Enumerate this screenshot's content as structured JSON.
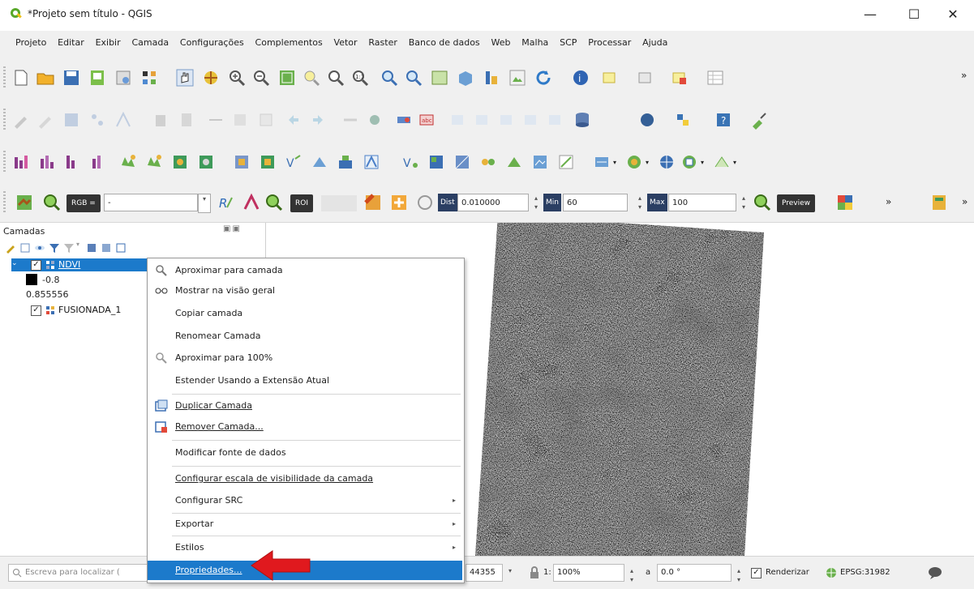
{
  "window": {
    "title": "*Projeto sem título - QGIS",
    "min_glyph": "—",
    "max_glyph": "☐",
    "close_glyph": "✕"
  },
  "menubar": [
    "Projeto",
    "Editar",
    "Exibir",
    "Camada",
    "Configurações",
    "Complementos",
    "Vetor",
    "Raster",
    "Banco de dados",
    "Web",
    "Malha",
    "SCP",
    "Processar",
    "Ajuda"
  ],
  "scp_toolbar": {
    "rgb_label": "RGB =",
    "rgb_value": "-",
    "roi_label": "ROI",
    "dist_label": "Dist",
    "dist_value": "0.010000",
    "min_label": "Min",
    "min_value": "60",
    "max_label": "Max",
    "max_value": "100",
    "preview_label": "Preview",
    "overflow": "»"
  },
  "layers_panel": {
    "title": "Camadas",
    "layers": [
      {
        "name": "NDVI",
        "checked": true,
        "selected": true
      },
      {
        "name": "FUSIONADA_1",
        "checked": true,
        "selected": false
      }
    ],
    "legend": [
      {
        "label": "-0.8",
        "color": "#000000"
      },
      {
        "label": "0.855556",
        "color": "#ffffff"
      }
    ]
  },
  "context_menu": {
    "items": [
      {
        "label": "Aproximar para camada",
        "icon": "zoom-layer-icon"
      },
      {
        "label": "Mostrar na visão geral",
        "icon": "overview-icon"
      },
      {
        "label": "Copiar camada",
        "icon": ""
      },
      {
        "label": "Renomear Camada",
        "icon": ""
      },
      {
        "label": "Aproximar para 100%",
        "icon": "zoom-native-icon"
      },
      {
        "label": "Estender Usando a Extensão Atual",
        "icon": ""
      },
      {
        "label": "Duplicar Camada",
        "icon": "duplicate-icon"
      },
      {
        "label": "Remover Camada...",
        "icon": "remove-layer-icon"
      },
      {
        "label": "Modificar fonte de dados",
        "icon": ""
      },
      {
        "label": "Configurar escala de visibilidade da camada",
        "icon": ""
      },
      {
        "label": "Configurar SRC",
        "icon": "",
        "submenu": true
      },
      {
        "label": "Exportar",
        "icon": "",
        "submenu": true
      },
      {
        "label": "Estilos",
        "icon": "",
        "submenu": true
      },
      {
        "label": "Propriedades...",
        "icon": "",
        "highlighted": true
      }
    ],
    "submenu_arrow": "▸"
  },
  "statusbar": {
    "locator_placeholder": "Escreva para localizar (",
    "coordinate": "44355",
    "scale_prefix": "1:",
    "magnifier": "100%",
    "rotation_prefix": "a",
    "rotation": "0.0 °",
    "render_label": "Renderizar",
    "render_checked": true,
    "crs": "EPSG:31982"
  },
  "colors": {
    "accent": "#1c7acb",
    "annotation_arrow": "#e0191e",
    "title_icon": "#58a829"
  }
}
